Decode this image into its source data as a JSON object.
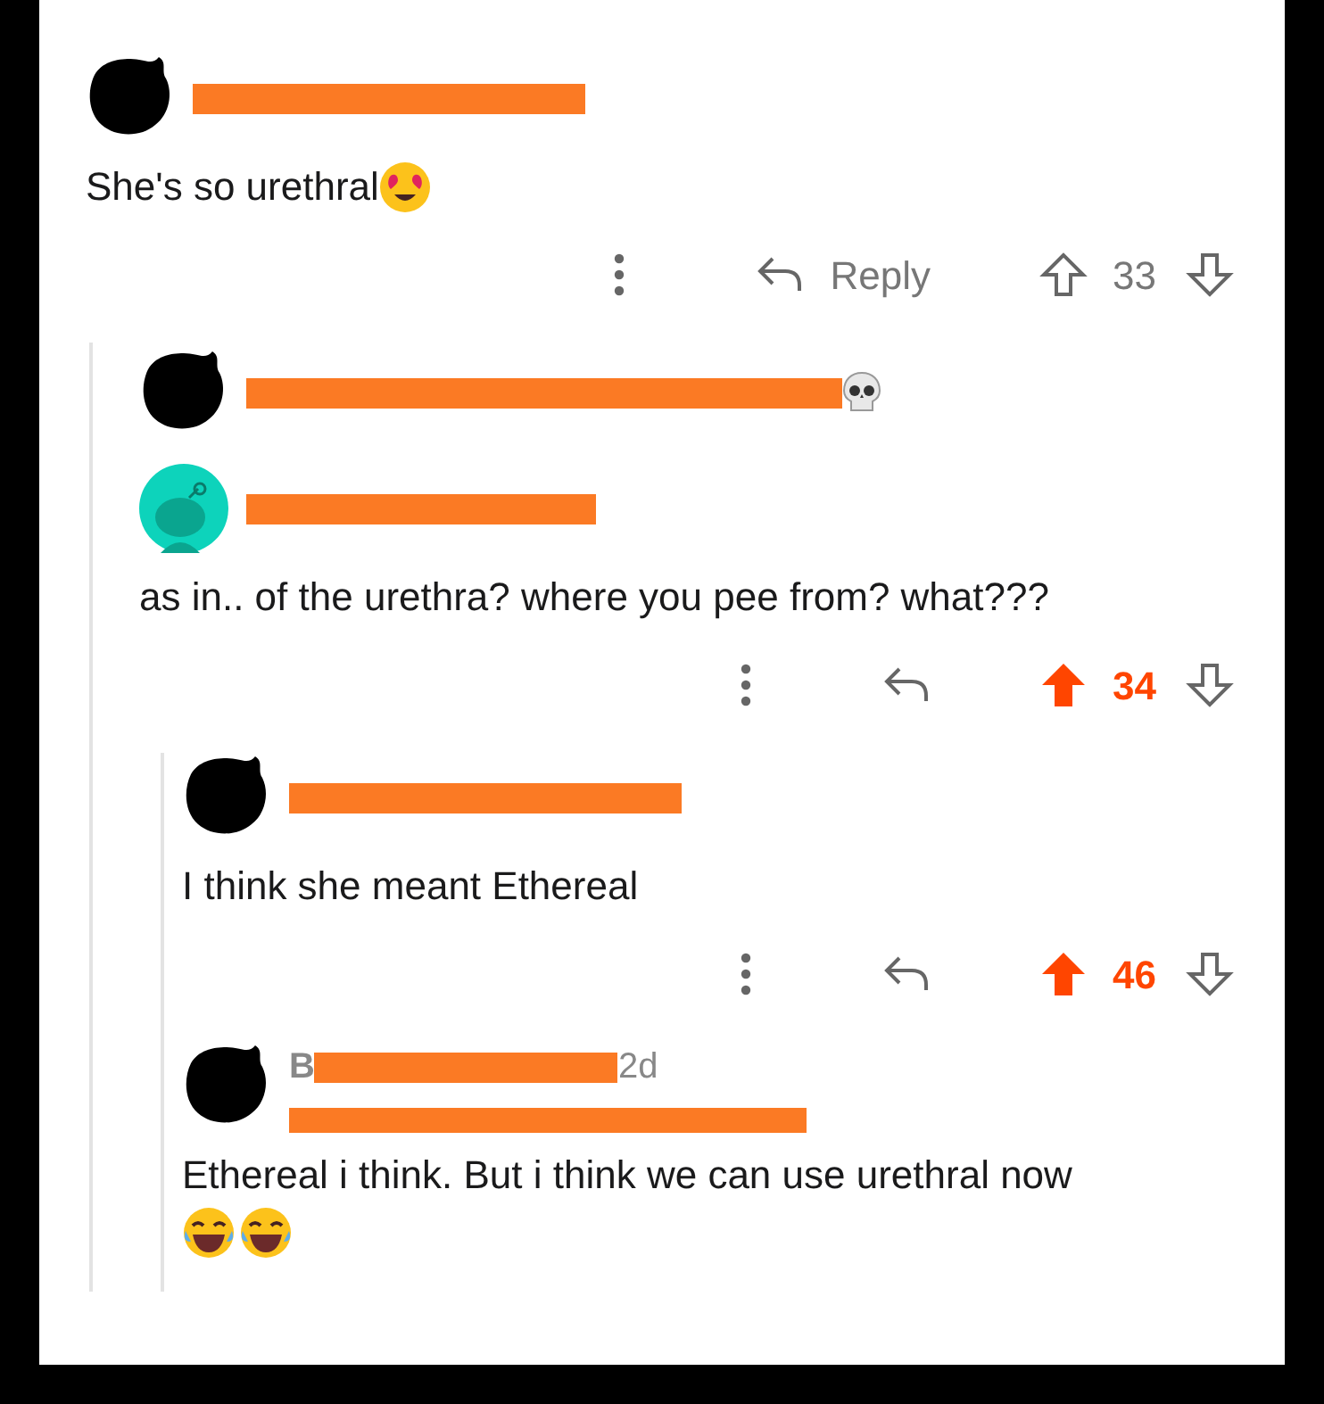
{
  "comments": [
    {
      "avatar": {
        "kind": "hidden"
      },
      "header": {
        "redacted": true
      },
      "text": "She's so urethral",
      "trailing_icons": [
        {
          "kind": "heart-eyes"
        }
      ],
      "actions": {
        "reply_label": "Reply",
        "score": "33",
        "upvoted": false
      },
      "children": [
        {
          "avatar": {
            "kind": "hidden"
          },
          "header": {
            "redacted": true,
            "trailing_icons": [
              {
                "kind": "skull"
              }
            ]
          }
        },
        {
          "avatar": {
            "kind": "default"
          },
          "header": {
            "redacted": true
          },
          "text": "as in.. of the urethra? where you pee from? what???",
          "actions": {
            "score": "34",
            "upvoted": true
          },
          "children": [
            {
              "avatar": {
                "kind": "hidden"
              },
              "header": {
                "redacted": true
              },
              "text": "I think she meant Ethereal",
              "actions": {
                "score": "46",
                "upvoted": true
              }
            },
            {
              "avatar": {
                "kind": "hidden"
              },
              "header": {
                "redacted": true,
                "author": "B",
                "time": "2d",
                "flair_redacted": true
              },
              "text": "Ethereal i think. But i think we can use urethral now",
              "emoji_line": [
                {
                  "kind": "laughing"
                },
                {
                  "kind": "laughing"
                }
              ]
            }
          ]
        }
      ]
    }
  ]
}
